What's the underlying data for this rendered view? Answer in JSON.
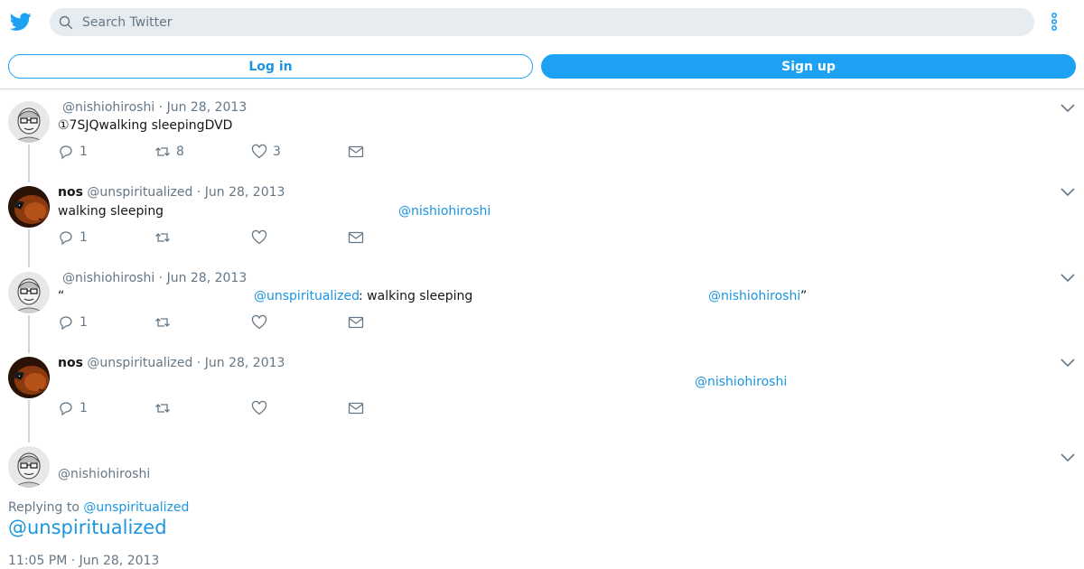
{
  "search": {
    "placeholder": "Search Twitter"
  },
  "auth": {
    "login_label": "Log in",
    "signup_label": "Sign up"
  },
  "tweets": [
    {
      "name": "",
      "handle": "@nishiohiroshi",
      "date": "· Jun 28, 2013",
      "text_plain": "①7SJQwalking sleepingDVD",
      "replies": "1",
      "retweets": "8",
      "likes": "3"
    },
    {
      "name": "nos",
      "handle": "@unspiritualized",
      "date": "· Jun 28, 2013",
      "text_plain": "walking sleeping",
      "mention": "@nishiohiroshi",
      "replies": "1",
      "retweets": "",
      "likes": ""
    },
    {
      "name": "",
      "handle": "@nishiohiroshi",
      "date": "· Jun 28, 2013",
      "open_quote": "“",
      "mention1": "@unspiritualized",
      "text_mid": ": walking sleeping",
      "mention2": "@nishiohiroshi",
      "close_quote": "”",
      "replies": "1",
      "retweets": "",
      "likes": ""
    },
    {
      "name": "nos",
      "handle": "@unspiritualized",
      "date": "· Jun 28, 2013",
      "mention": "@nishiohiroshi",
      "replies": "1",
      "retweets": "",
      "likes": ""
    }
  ],
  "focused": {
    "handle": "@nishiohiroshi",
    "replying_prefix": "Replying to",
    "replying_handle": "@unspiritualized",
    "body_mention": "@unspiritualized",
    "timestamp": "11:05 PM · Jun 28, 2013"
  },
  "colors": {
    "accent": "#1da1f2",
    "link": "#1b95e0",
    "muted": "#657786",
    "divider": "#ccd6dd"
  },
  "icons": [
    "twitter-bird-icon",
    "search-icon",
    "more-vertical-icon",
    "chevron-down-icon",
    "reply-icon",
    "retweet-icon",
    "like-icon",
    "direct-message-icon"
  ]
}
